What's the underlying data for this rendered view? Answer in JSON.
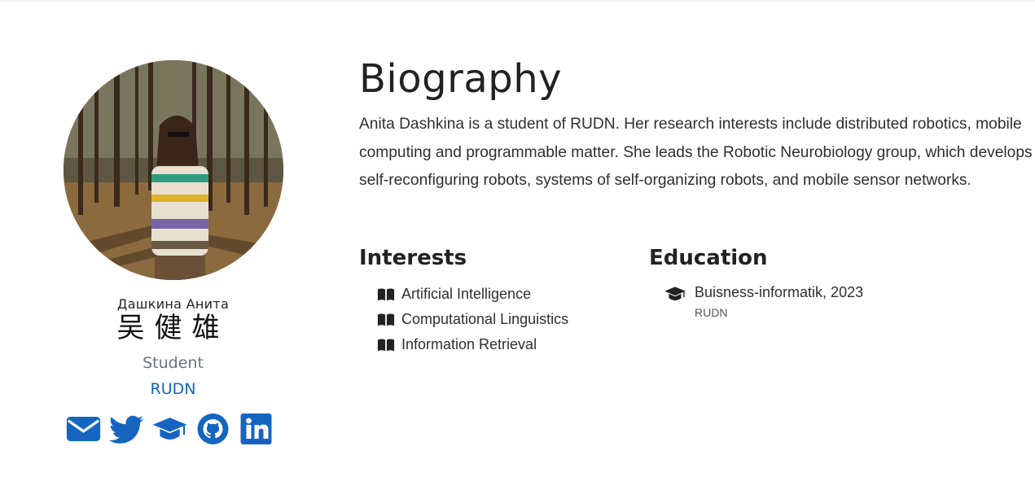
{
  "profile": {
    "name": "Дашкина Анита",
    "name_cn": "吴健雄",
    "role": "Student",
    "organization": "RUDN",
    "social": [
      {
        "icon": "envelope-icon"
      },
      {
        "icon": "twitter-icon"
      },
      {
        "icon": "graduation-cap-icon"
      },
      {
        "icon": "github-icon"
      },
      {
        "icon": "linkedin-icon"
      }
    ],
    "accent_color": "#1565c0"
  },
  "biography": {
    "title": "Biography",
    "text": "Anita Dashkina is a student of RUDN. Her research interests include distributed robotics, mobile computing and programmable matter. She leads the Robotic Neurobiology group, which develops self-reconfiguring robots, systems of self-organizing robots, and mobile sensor networks."
  },
  "interests": {
    "title": "Interests",
    "items": [
      {
        "label": "Artificial Intelligence",
        "icon": "book-icon"
      },
      {
        "label": "Computational Linguistics",
        "icon": "book-icon"
      },
      {
        "label": "Information Retrieval",
        "icon": "book-icon"
      }
    ]
  },
  "education": {
    "title": "Education",
    "items": [
      {
        "course": "Buisness-informatik, 2023",
        "institution": "RUDN",
        "icon": "graduation-cap-icon"
      }
    ]
  }
}
